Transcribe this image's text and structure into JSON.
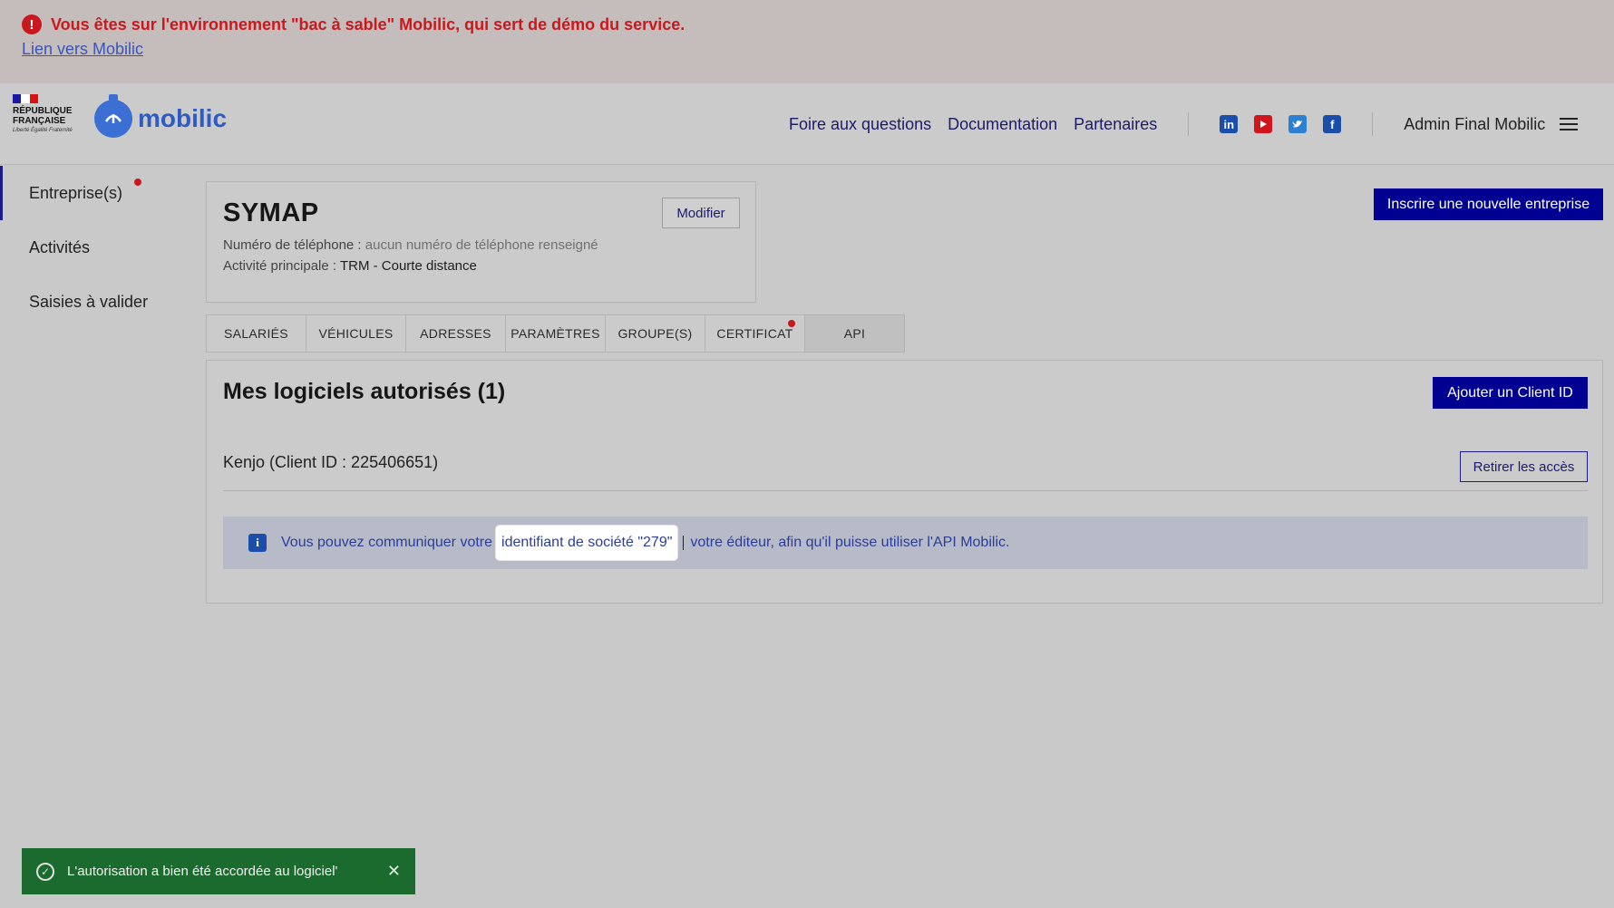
{
  "sandbox": {
    "message": "Vous êtes sur l'environnement \"bac à sable\" Mobilic, qui sert de démo du service.",
    "link_label": "Lien vers Mobilic"
  },
  "header": {
    "republique_line1": "RÉPUBLIQUE",
    "republique_line2": "FRANÇAISE",
    "motto": "Liberté Égalité Fraternité",
    "brand_name": "mobilic",
    "nav": [
      "Foire aux questions",
      "Documentation",
      "Partenaires"
    ],
    "social_icons": [
      "linkedin-icon",
      "youtube-icon",
      "twitter-icon",
      "facebook-icon"
    ],
    "user_name": "Admin Final Mobilic"
  },
  "sidebar": {
    "items": [
      {
        "label": "Entreprise(s)",
        "active": true,
        "notification": true
      },
      {
        "label": "Activités",
        "active": false,
        "notification": false
      },
      {
        "label": "Saisies à valider",
        "active": false,
        "notification": false
      }
    ]
  },
  "company": {
    "name": "SYMAP",
    "modify_label": "Modifier",
    "phone_label": "Numéro de téléphone :",
    "phone_value": "aucun numéro de téléphone renseigné",
    "activity_label": "Activité principale :",
    "activity_value": "TRM - Courte distance",
    "new_company_label": "Inscrire une nouvelle entreprise"
  },
  "tabs": [
    {
      "label": "SALARIÉS"
    },
    {
      "label": "VÉHICULES"
    },
    {
      "label": "ADRESSES"
    },
    {
      "label": "PARAMÈTRES"
    },
    {
      "label": "GROUPE(S)"
    },
    {
      "label": "CERTIFICAT",
      "notification": true
    },
    {
      "label": "API",
      "active": true
    }
  ],
  "api_panel": {
    "title": "Mes logiciels autorisés (1)",
    "add_client_label": "Ajouter un Client ID",
    "client_name": "Kenjo (Client ID : 225406651)",
    "revoke_label": "Retirer les accès",
    "info_prefix": "Vous pouvez communiquer votre",
    "info_highlight": "identifiant de société \"279\"",
    "info_suffix": "votre éditeur, afin qu'il puisse utiliser l'API Mobilic."
  },
  "toast": {
    "message": "L'autorisation a bien été accordée au logiciel'"
  },
  "colors": {
    "primary": "#000091",
    "alert_red": "#c9191e",
    "toast_green": "#1c6b2e",
    "info_blue": "#2a3d9a"
  }
}
